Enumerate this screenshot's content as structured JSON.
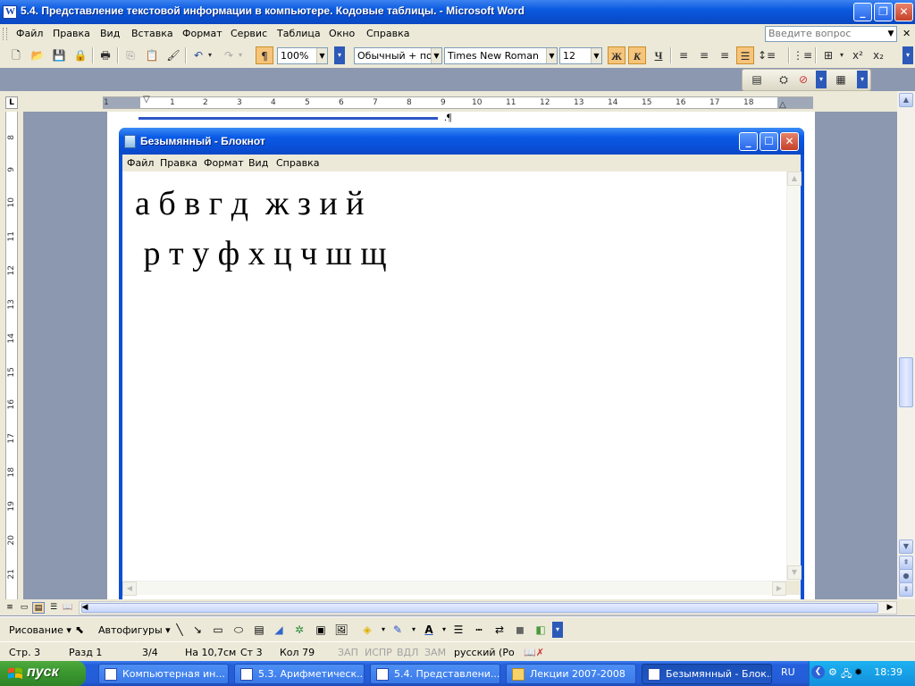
{
  "word": {
    "title": "5.4. Представление текстовой информации в компьютере. Кодовые таблицы. - Microsoft Word",
    "menu": [
      "Файл",
      "Правка",
      "Вид",
      "Вставка",
      "Формат",
      "Сервис",
      "Таблица",
      "Окно",
      "Справка"
    ],
    "help_placeholder": "Введите вопрос",
    "zoom": "100%",
    "style": "Обычный + пол",
    "font": "Times New Roman",
    "font_size": "12",
    "bold": "Ж",
    "italic": "К",
    "underline": "Ч",
    "ruler_numbers": [
      "1",
      "1",
      "2",
      "3",
      "4",
      "5",
      "6",
      "7",
      "8",
      "9",
      "10",
      "11",
      "12",
      "13",
      "14",
      "15",
      "16",
      "17",
      "18"
    ],
    "vruler_numbers": [
      "8",
      "9",
      "10",
      "11",
      "12",
      "13",
      "14",
      "15",
      "16",
      "17",
      "18",
      "19",
      "20",
      "21"
    ],
    "drawing": {
      "draw_label": "Рисование ▾",
      "autoshapes_label": "Автофигуры ▾"
    },
    "status": {
      "page": "Стр. 3",
      "section": "Разд 1",
      "pages": "3/4",
      "at": "На 10,7см",
      "line": "Ст 3",
      "col": "Кол 79",
      "rec": "ЗАП",
      "trk": "ИСПР",
      "ext": "ВДЛ",
      "ovr": "ЗАМ",
      "lang": "русский (Ро"
    }
  },
  "notepad": {
    "title": "Безымянный - Блокнот",
    "menu": [
      "Файл",
      "Правка",
      "Формат",
      "Вид",
      "Справка"
    ],
    "content": "а б в г д  ж з и й\n р т у ф х ц ч ш щ"
  },
  "taskbar": {
    "start": "пуск",
    "tasks": [
      "Компьютерная ин...",
      "5.3. Арифметическ...",
      "5.4. Представлени...",
      "Лекции 2007-2008",
      "Безымянный - Блок..."
    ],
    "lang": "RU",
    "time": "18:39"
  },
  "colors": {
    "xp_blue": "#0a5ae0",
    "start_green": "#3c9a31",
    "tray_blue": "#1290dd"
  }
}
